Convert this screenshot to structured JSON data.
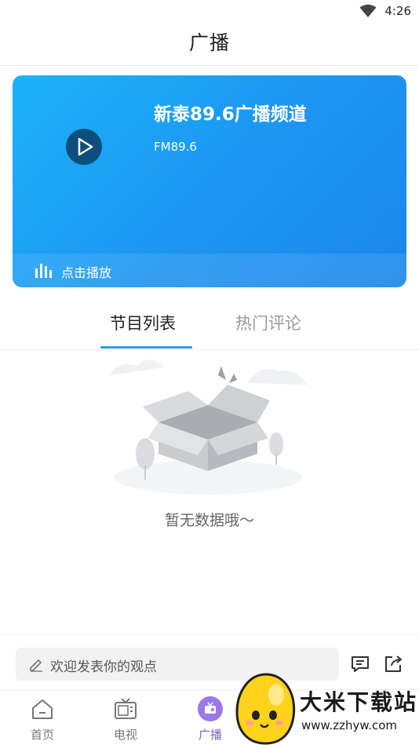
{
  "status_bar": {
    "time": "4:26",
    "wifi_icon": "wifi-icon"
  },
  "header": {
    "title": "广播"
  },
  "player": {
    "channel_name": "新泰89.6广播频道",
    "frequency": "FM89.6",
    "play_label": "点击播放",
    "play_icon": "play-icon",
    "bars_icon": "audio-bars-icon",
    "gradient": [
      "#1db2f9",
      "#1a86ec"
    ]
  },
  "tabs": [
    {
      "label": "节目列表",
      "active": true
    },
    {
      "label": "热门评论",
      "active": false
    }
  ],
  "empty_state": {
    "text": "暂无数据哦～",
    "illustration": "empty-box-icon"
  },
  "comment_bar": {
    "placeholder": "欢迎发表你的观点",
    "comment_icon": "comment-icon",
    "share_icon": "share-icon"
  },
  "bottom_nav": [
    {
      "label": "首页",
      "icon": "home-icon"
    },
    {
      "label": "电视",
      "icon": "tv-icon"
    },
    {
      "label": "广播",
      "icon": "radio-icon",
      "active": true
    }
  ],
  "watermark": {
    "brand": "大米下载站",
    "url": "www.zzhyw.com"
  },
  "colors": {
    "accent": "#2ea0e0",
    "active_nav": "#7e5ddd"
  }
}
